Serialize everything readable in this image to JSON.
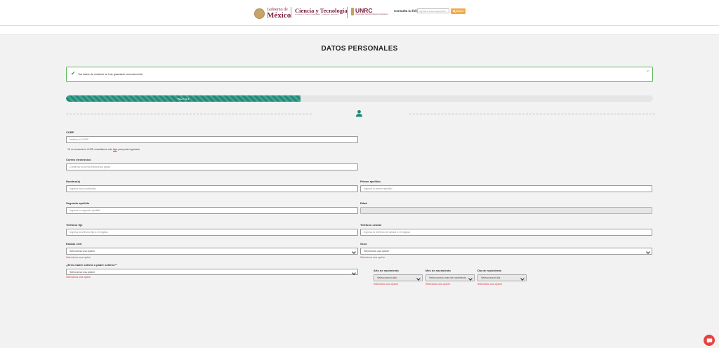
{
  "header": {
    "gob_small": "Gobierno de",
    "gob_big": "México",
    "ct_title": "Ciencia y Tecnología",
    "ct_sub": "Secretaría de Ciencia, Humanidades, Tecnología e Innovación",
    "unrc_title": "UNRC",
    "unrc_sub": "Universidad Nacional Rosario Castellanos",
    "folio_label": "Consulta tu folio",
    "folio_placeholder": "Ingresa tu correo electrónico",
    "folio_button": "Buscar"
  },
  "page": {
    "title": "DATOS PERSONALES"
  },
  "alert": {
    "message": "Tus datos de contacto se han guardado correctamente.",
    "close": "×"
  },
  "progress": {
    "label": "Paso 1 de 2",
    "percent": 40
  },
  "form": {
    "curp": {
      "label": "CURP",
      "placeholder": "Verifica tu CURP"
    },
    "curp_note": {
      "text": "*Si no recuerdas tu CURP, consúltala en este",
      "link": "liga",
      "tail": ", para poder ingresarla."
    },
    "email": {
      "label": "Correo electrónico",
      "placeholder": "Confirma tu correo electrónico gmail"
    },
    "nombre": {
      "label": "Nombre(s)",
      "placeholder": "Ingresa tu(s) nombre(s)"
    },
    "primer_apellido": {
      "label": "Primer apellido",
      "placeholder": "Ingresa tu primer apellido"
    },
    "segundo_apellido": {
      "label": "Segundo apellido",
      "placeholder": "Ingresa tu segundo apellido"
    },
    "edad": {
      "label": "Edad",
      "value": ""
    },
    "telefono_fijo": {
      "label": "Teléfono fijo",
      "placeholder": "Ingresa tu teléfono fijo a 10 dígitos"
    },
    "telefono_celular": {
      "label": "Teléfono celular",
      "placeholder": "Ingresa tu teléfono de celular a 10 dígitos"
    },
    "estado_civil": {
      "label": "Estado civil",
      "selected": "Selecciona una opción",
      "error": "Selecciona una opción"
    },
    "sexo": {
      "label": "Sexo",
      "selected": "Selecciona una opción",
      "error": "Selecciona una opción"
    },
    "madre_padre": {
      "label": "¿Eres madre soltera o padre soltero?*",
      "selected": "Selecciona una opción",
      "error": "Selecciona una opción"
    },
    "anio_nacimiento": {
      "label": "Año de nacimiento",
      "selected": "Selecciona el año",
      "error": "Selecciona una opción"
    },
    "mes_nacimiento": {
      "label": "Mes de nacimiento",
      "selected": "Selecciona tu mes de nacimiento",
      "error": "Selecciona una opción"
    },
    "dia_nacimiento": {
      "label": "Día de nacimiento",
      "selected": "Selecciona el día",
      "error": "Selecciona una opción"
    }
  },
  "colors": {
    "accent": "#1d8b77",
    "success": "#5cb85c",
    "error": "#d9363e",
    "brand": "#7a1f3a",
    "search_button": "#f0ad4e",
    "chat": "#e8423f"
  },
  "icons": {
    "alert": "check-icon",
    "step": "user-icon",
    "chat": "chat-icon",
    "folio": "search-icon"
  }
}
